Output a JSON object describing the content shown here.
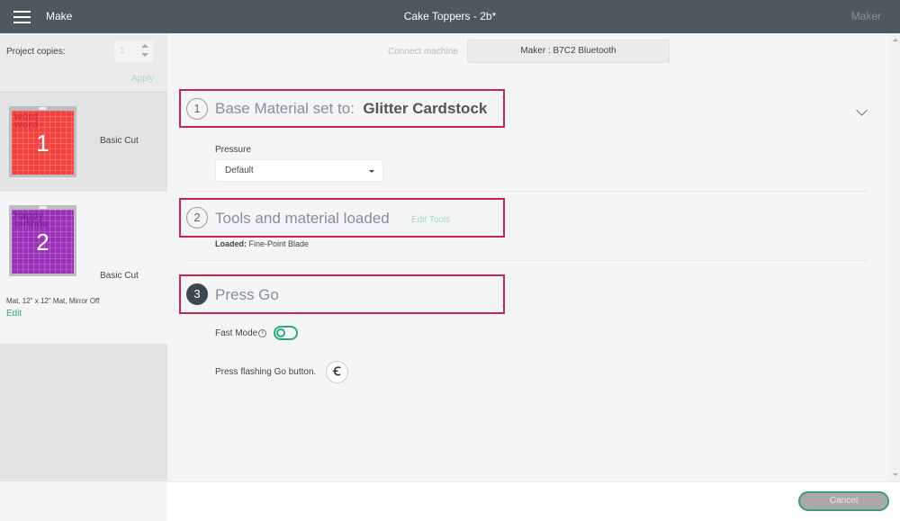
{
  "topbar": {
    "menu_icon": "hamburger-menu-icon",
    "section": "Make",
    "project_title": "Cake Toppers - 2b*",
    "machine": "Maker"
  },
  "sidebar": {
    "project_copies_label": "Project copies:",
    "project_copies_value": "1",
    "apply_label": "Apply",
    "mats": [
      {
        "number": "1",
        "label": "Basic Cut",
        "color": "#f2413f",
        "text_color": "#c8282c",
        "thumb_text": "word word"
      },
      {
        "number": "2",
        "label": "Basic Cut",
        "color": "#9a2fb8",
        "text_color": "#6e1f8f",
        "thumb_text": "happy birthday"
      }
    ],
    "mat_info": "Mat, 12\" x 12\" Mat, Mirror Off",
    "edit_label": "Edit"
  },
  "connect": {
    "label": "Connect machine",
    "machine_button": "Maker : B7C2 Bluetooth"
  },
  "steps": [
    {
      "number": "1",
      "title": "Base Material set to:",
      "value": "Glitter Cardstock"
    },
    {
      "number": "2",
      "title": "Tools and material loaded",
      "link": "Edit Tools"
    },
    {
      "number": "3",
      "title": "Press Go"
    }
  ],
  "pressure": {
    "label": "Pressure",
    "selected": "Default"
  },
  "loaded": {
    "label": "Loaded:",
    "value": "Fine-Point Blade"
  },
  "fast_mode": {
    "label": "Fast Mode",
    "info_icon": "i",
    "enabled": false
  },
  "press_go": {
    "label": "Press flashing Go button.",
    "go_icon": "Ꞓ"
  },
  "footer": {
    "cancel_label": "Cancel"
  },
  "colors": {
    "accent": "#2ea97f",
    "highlight_box": "#c8254f",
    "topbar": "#4e5860"
  }
}
